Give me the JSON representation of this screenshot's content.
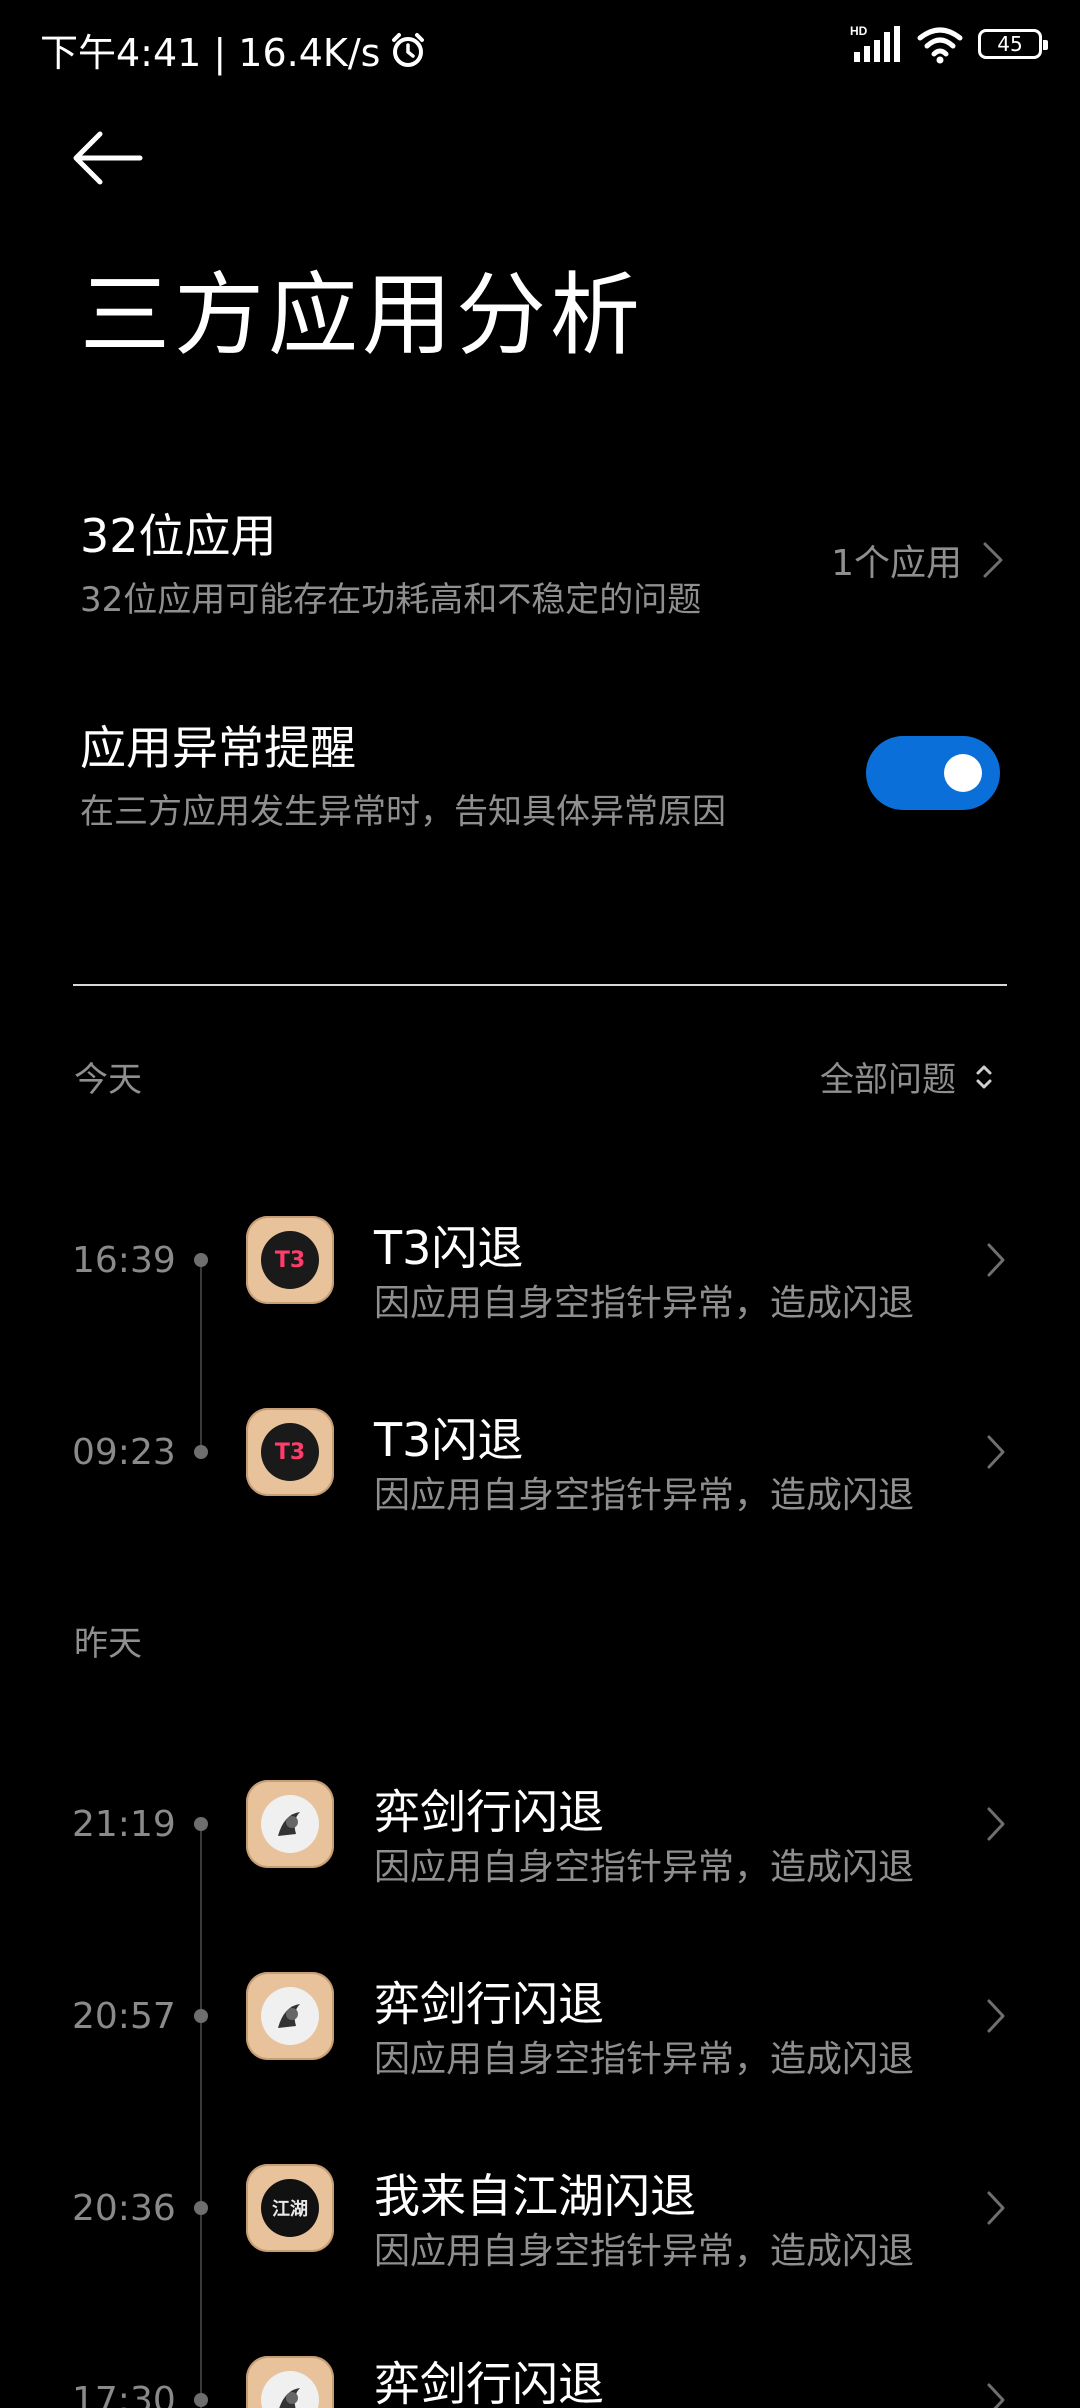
{
  "status_bar": {
    "time_speed": "下午4:41 | 16.4K/s",
    "battery": "45",
    "signal_badge": "HD"
  },
  "header": {
    "title": "三方应用分析"
  },
  "settings": {
    "app32": {
      "title": "32位应用",
      "subtitle": "32位应用可能存在功耗高和不稳定的问题",
      "value": "1个应用"
    },
    "exception_alert": {
      "title": "应用异常提醒",
      "subtitle": "在三方应用发生异常时，告知具体异常原因",
      "enabled": true
    }
  },
  "filter": {
    "label": "全部问题"
  },
  "sections": [
    {
      "label": "今天",
      "events": [
        {
          "time": "16:39",
          "title": "T3闪退",
          "desc": "因应用自身空指针异常，造成闪退",
          "icon_text": "T3"
        },
        {
          "time": "09:23",
          "title": "T3闪退",
          "desc": "因应用自身空指针异常，造成闪退",
          "icon_text": "T3"
        }
      ]
    },
    {
      "label": "昨天",
      "events": [
        {
          "time": "21:19",
          "title": "弈剑行闪退",
          "desc": "因应用自身空指针异常，造成闪退",
          "icon_text": ""
        },
        {
          "time": "20:57",
          "title": "弈剑行闪退",
          "desc": "因应用自身空指针异常，造成闪退",
          "icon_text": ""
        },
        {
          "time": "20:36",
          "title": "我来自江湖闪退",
          "desc": "因应用自身空指针异常，造成闪退",
          "icon_text": "江湖"
        },
        {
          "time": "17:30",
          "title": "弈剑行闪退",
          "desc": "",
          "icon_text": ""
        }
      ]
    }
  ],
  "colors": {
    "background": "#000000",
    "accent": "#0a6fd8",
    "secondary_text": "#8f8f8f"
  }
}
